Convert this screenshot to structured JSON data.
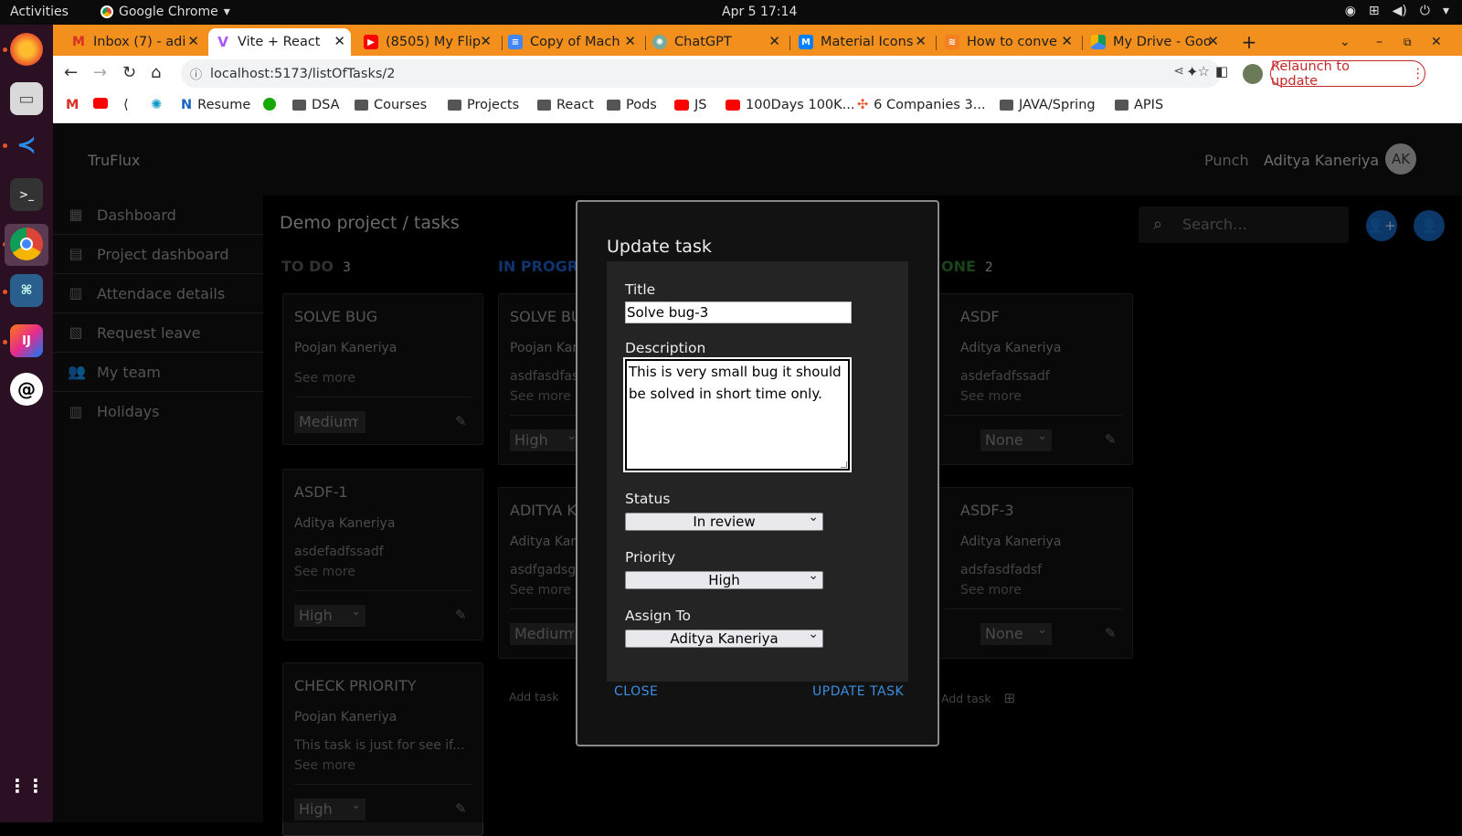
{
  "system": {
    "activities": "Activities",
    "app_name": "Google Chrome",
    "clock": "Apr 5  17:14"
  },
  "browser": {
    "tabs": [
      {
        "label": "Inbox (7) - adi",
        "favicon": "gmail-icon"
      },
      {
        "label": "Vite + React",
        "favicon": "vite-icon"
      },
      {
        "label": "(8505) My Flip",
        "favicon": "youtube-icon"
      },
      {
        "label": "Copy of Mach",
        "favicon": "docs-icon"
      },
      {
        "label": "ChatGPT",
        "favicon": "chatgpt-icon"
      },
      {
        "label": "Material Icons",
        "favicon": "mui-icon"
      },
      {
        "label": "How to conve",
        "favicon": "stackoverflow-icon"
      },
      {
        "label": "My Drive - Goo",
        "favicon": "drive-icon"
      }
    ],
    "new_tab": "+",
    "url": "localhost:5173/listOfTasks/2",
    "relaunch": "Relaunch to update",
    "bookmarks": [
      "Resume",
      "DSA",
      "Courses",
      "Projects",
      "React",
      "Pods",
      "JS",
      "100Days 100K...",
      "6 Companies 3...",
      "JAVA/Spring",
      "APIS"
    ]
  },
  "app": {
    "brand": "TruFlux",
    "punch": "Punch",
    "user_name": "Aditya Kaneriya",
    "avatar_initials": "AK",
    "nav": [
      "Dashboard",
      "Project dashboard",
      "Attendace details",
      "Request leave",
      "My team",
      "Holidays"
    ],
    "breadcrumb": "Demo project  / tasks",
    "search_placeholder": "Search…",
    "columns": {
      "todo": {
        "title": "TO DO",
        "count": "3",
        "color": "#5a5a5a"
      },
      "inprogress": {
        "title": "IN PROGRE",
        "color": "#1e5fc8"
      },
      "done": {
        "title": "ONE",
        "count": "2",
        "color": "#2e7d32"
      }
    },
    "cards": {
      "todo": [
        {
          "title": "SOLVE BUG",
          "assignee": "Poojan Kaneriya",
          "desc": "",
          "see_more": "See more",
          "priority": "Medium"
        },
        {
          "title": "ASDF-1",
          "assignee": "Aditya Kaneriya",
          "desc": "asdefadfssadf",
          "see_more": "See more",
          "priority": "High"
        },
        {
          "title": "CHECK PRIORITY",
          "assignee": "Poojan Kaneriya",
          "desc": "This task is just for see if...",
          "see_more": "See more",
          "priority": "High"
        }
      ],
      "inprogress": [
        {
          "title": "SOLVE BU",
          "assignee": "Poojan Kan",
          "desc": "asdfasdfasc",
          "see_more": "See more",
          "priority": "High"
        },
        {
          "title": "ADITYA K",
          "assignee": "Aditya Kane",
          "desc": "asdfgadsga",
          "see_more": "See more",
          "priority": "Medium"
        }
      ],
      "done": [
        {
          "title": "ASDF",
          "assignee": "Aditya Kaneriya",
          "desc": "asdefadfssadf",
          "see_more": "See more",
          "priority": "None"
        },
        {
          "title": "ASDF-3",
          "assignee": "Aditya Kaneriya",
          "desc": "adsfasdfadsf",
          "see_more": "See more",
          "priority": "None"
        }
      ]
    },
    "add_task": "Add task"
  },
  "modal": {
    "title": "Update task",
    "title_label": "Title",
    "title_value": "Solve bug-3",
    "description_label": "Description",
    "description_value": "This is very small bug it should be solved in short time only.",
    "status_label": "Status",
    "status_value": "In review",
    "priority_label": "Priority",
    "priority_value": "High",
    "assign_label": "Assign To",
    "assign_value": "Aditya Kaneriya",
    "close": "CLOSE",
    "update": "UPDATE TASK"
  }
}
